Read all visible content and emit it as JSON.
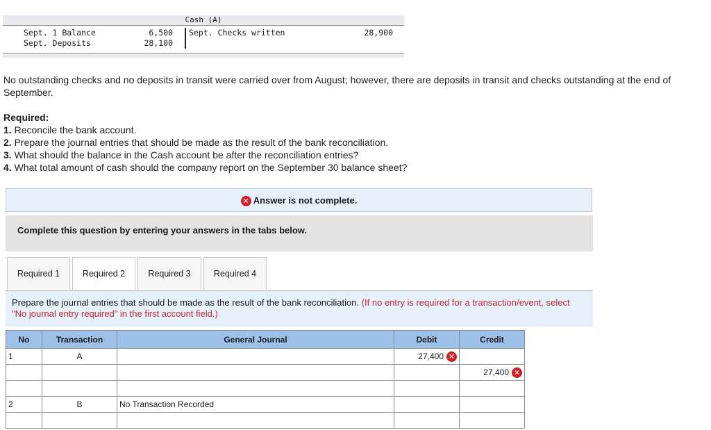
{
  "t_account": {
    "title": "Cash (A)",
    "debit_rows": [
      {
        "label": "Sept. 1 Balance",
        "amount": "6,500"
      },
      {
        "label": "Sept. Deposits",
        "amount": "28,100"
      }
    ],
    "credit_rows": [
      {
        "label": "Sept. Checks written",
        "amount": "28,900"
      }
    ]
  },
  "intro_text": "No outstanding checks and no deposits in transit were carried over from August; however, there are deposits in transit and checks outstanding at the end of September.",
  "required": {
    "heading": "Required:",
    "items": [
      {
        "num": "1.",
        "text": "Reconcile the bank account."
      },
      {
        "num": "2.",
        "text": "Prepare the journal entries that should be made as the result of the bank reconciliation."
      },
      {
        "num": "3.",
        "text": "What should the balance in the Cash account be after the reconciliation entries?"
      },
      {
        "num": "4.",
        "text": "What total amount of cash should the company report on the September 30 balance sheet?"
      }
    ]
  },
  "answer_status": {
    "icon": "x-circle-icon",
    "text": "Answer is not complete."
  },
  "complete_prompt": "Complete this question by entering your answers in the tabs below.",
  "tabs": [
    {
      "label": "Required 1",
      "active": false
    },
    {
      "label": "Required 2",
      "active": true
    },
    {
      "label": "Required 3",
      "active": false
    },
    {
      "label": "Required 4",
      "active": false
    }
  ],
  "instruction": {
    "main": "Prepare the journal entries that should be made as the result of the bank reconciliation.",
    "note": "(If no entry is required for a transaction/event, select \"No journal entry required\" in the first account field.)"
  },
  "journal": {
    "headers": {
      "no": "No",
      "transaction": "Transaction",
      "general_journal": "General Journal",
      "debit": "Debit",
      "credit": "Credit"
    },
    "rows": [
      {
        "no": "1",
        "transaction": "A",
        "account": "",
        "debit": "27,400",
        "debit_status": "incorrect",
        "credit": "",
        "credit_status": ""
      },
      {
        "no": "",
        "transaction": "",
        "account": "",
        "debit": "",
        "debit_status": "",
        "credit": "27,400",
        "credit_status": "incorrect"
      },
      {
        "no": "",
        "transaction": "",
        "account": "",
        "debit": "",
        "debit_status": "",
        "credit": "",
        "credit_status": ""
      },
      {
        "no": "2",
        "transaction": "B",
        "account": "No Transaction Recorded",
        "debit": "",
        "debit_status": "",
        "credit": "",
        "credit_status": ""
      },
      {
        "no": "",
        "transaction": "",
        "account": "",
        "debit": "",
        "debit_status": "",
        "credit": "",
        "credit_status": ""
      }
    ]
  },
  "colors": {
    "header_blue": "#9ec1ea",
    "light_blue": "#e6f0fa",
    "error_red": "#d21f26",
    "note_red": "#c0282d",
    "gray_box": "#e3e3e3"
  }
}
